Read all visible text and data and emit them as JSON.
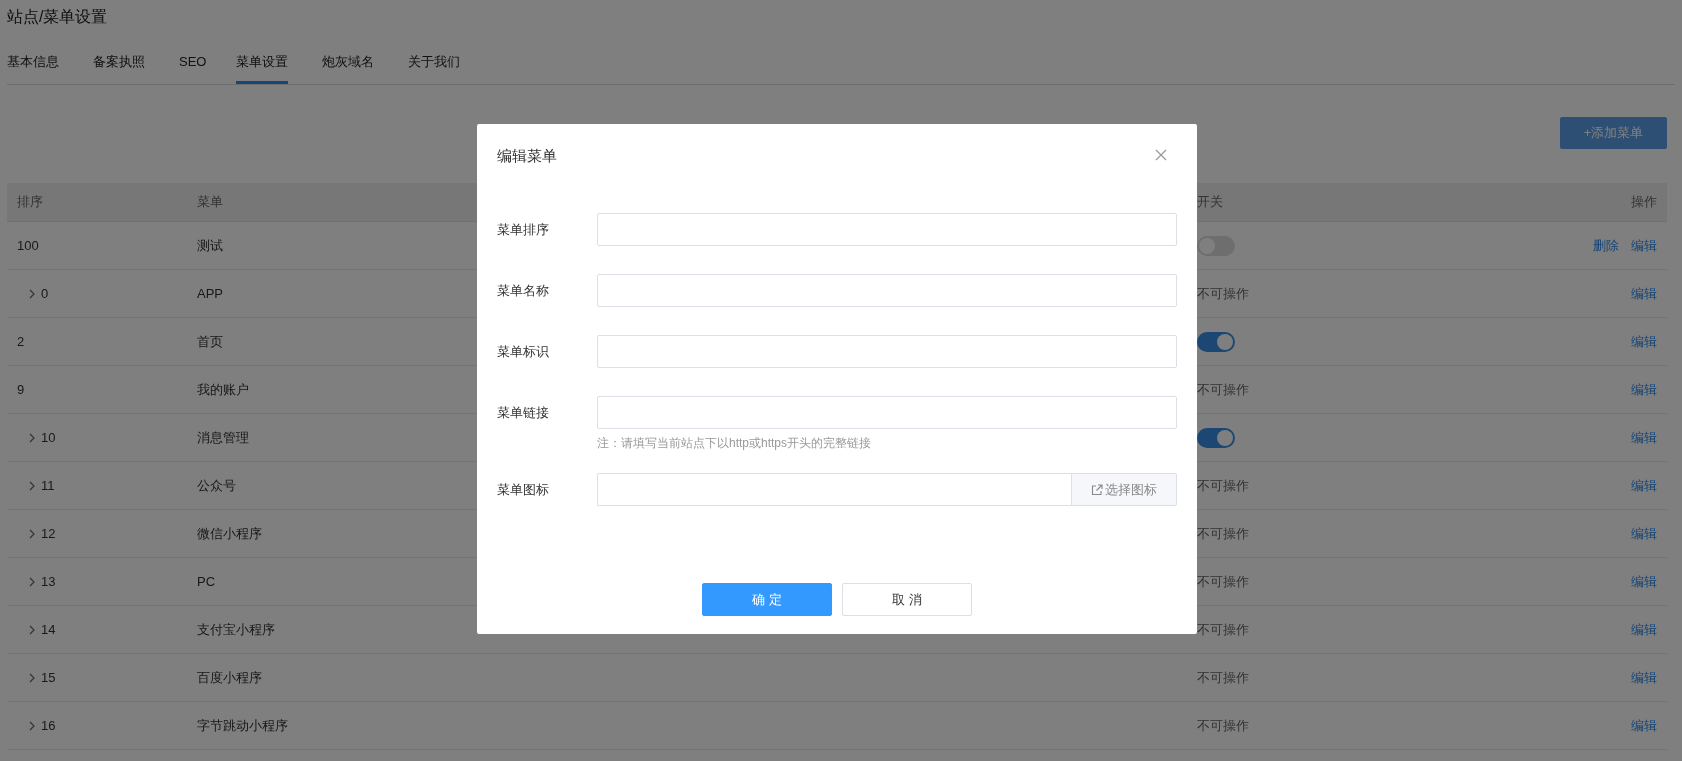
{
  "page": {
    "title": "站点/菜单设置"
  },
  "tabs": [
    {
      "label": "基本信息",
      "selected": false
    },
    {
      "label": "备案执照",
      "selected": false
    },
    {
      "label": "SEO",
      "selected": false
    },
    {
      "label": "菜单设置",
      "selected": true
    },
    {
      "label": "炮灰域名",
      "selected": false
    },
    {
      "label": "关于我们",
      "selected": false
    }
  ],
  "add_button": "+添加菜单",
  "table": {
    "columns": [
      "排序",
      "菜单",
      "开关",
      "操作"
    ],
    "rows": [
      {
        "order": "100",
        "name": "测试",
        "expandable": false,
        "switch": {
          "kind": "toggle",
          "on": false
        },
        "actions": [
          "删除",
          "编辑"
        ]
      },
      {
        "order": "0",
        "name": "APP",
        "expandable": true,
        "switch": {
          "kind": "text",
          "text": "不可操作"
        },
        "actions": [
          "编辑"
        ]
      },
      {
        "order": "2",
        "name": "首页",
        "expandable": false,
        "switch": {
          "kind": "toggle",
          "on": true
        },
        "actions": [
          "编辑"
        ]
      },
      {
        "order": "9",
        "name": "我的账户",
        "expandable": false,
        "switch": {
          "kind": "text",
          "text": "不可操作"
        },
        "actions": [
          "编辑"
        ]
      },
      {
        "order": "10",
        "name": "消息管理",
        "expandable": true,
        "switch": {
          "kind": "toggle",
          "on": true
        },
        "actions": [
          "编辑"
        ]
      },
      {
        "order": "11",
        "name": "公众号",
        "expandable": true,
        "switch": {
          "kind": "text",
          "text": "不可操作"
        },
        "actions": [
          "编辑"
        ]
      },
      {
        "order": "12",
        "name": "微信小程序",
        "expandable": true,
        "switch": {
          "kind": "text",
          "text": "不可操作"
        },
        "actions": [
          "编辑"
        ]
      },
      {
        "order": "13",
        "name": "PC",
        "expandable": true,
        "switch": {
          "kind": "text",
          "text": "不可操作"
        },
        "actions": [
          "编辑"
        ]
      },
      {
        "order": "14",
        "name": "支付宝小程序",
        "expandable": true,
        "switch": {
          "kind": "text",
          "text": "不可操作"
        },
        "actions": [
          "编辑"
        ]
      },
      {
        "order": "15",
        "name": "百度小程序",
        "expandable": true,
        "switch": {
          "kind": "text",
          "text": "不可操作"
        },
        "actions": [
          "编辑"
        ]
      },
      {
        "order": "16",
        "name": "字节跳动小程序",
        "expandable": true,
        "switch": {
          "kind": "text",
          "text": "不可操作"
        },
        "actions": [
          "编辑"
        ]
      }
    ]
  },
  "dialog": {
    "title": "编辑菜单",
    "fields": [
      {
        "kind": "input",
        "label": "菜单排序"
      },
      {
        "kind": "input",
        "label": "菜单名称"
      },
      {
        "kind": "input",
        "label": "菜单标识"
      },
      {
        "kind": "input",
        "label": "菜单链接",
        "note": "注：请填写当前站点下以http或https开头的完整链接"
      },
      {
        "kind": "icon_picker",
        "label": "菜单图标",
        "button": "选择图标"
      }
    ],
    "buttons": [
      {
        "kind": "primary",
        "label": "确 定"
      },
      {
        "kind": "default",
        "label": "取 消"
      }
    ]
  }
}
